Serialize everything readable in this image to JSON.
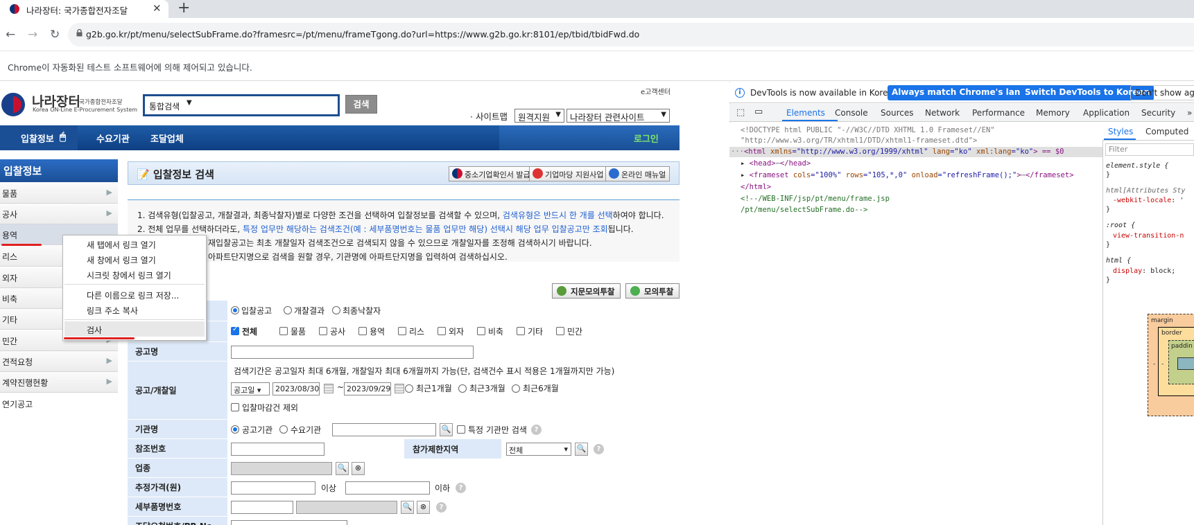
{
  "browser": {
    "tab_title": "나라장터: 국가종합전자조달",
    "tab_close": "✕",
    "new_tab": "+",
    "url": "g2b.go.kr/pt/menu/selectSubFrame.do?framesrc=/pt/menu/frameTgong.do?url=https://www.g2b.go.kr:8101/ep/tbid/tbidFwd.do",
    "automation_notice": "Chrome이 자동화된 테스트 소프트웨어에 의해 제어되고 있습니다."
  },
  "site": {
    "logo_name": "나라장터",
    "logo_sub": "국가종합전자조달",
    "logo_en": "Korea ON-Line E-Procurement System",
    "ecenter": "e고객센터",
    "search_select": "통합검색",
    "search_button": "검색",
    "sitemap": "· 사이트맵",
    "remote_support": "원격지원",
    "related_sites": "나라장터 관련사이트",
    "gnb": [
      "입찰정보",
      "수요기관",
      "조달업체"
    ],
    "login": "로그인"
  },
  "left_nav": {
    "title": "입찰정보",
    "items": [
      "물품",
      "공사",
      "용역",
      "리스",
      "외자",
      "비축",
      "기타",
      "민간",
      "견적요청",
      "계약진행현황",
      "연기공고"
    ]
  },
  "context_menu": {
    "items": [
      "새 탭에서 링크 열기",
      "새 창에서 링크 열기",
      "시크릿 창에서 링크 열기",
      "다른 이름으로 링크 저장...",
      "링크 주소 복사",
      "검사"
    ]
  },
  "page_header": {
    "title": "입찰정보 검색",
    "buttons": [
      "중소기업확인서 발급",
      "기업마당 지원사업",
      "온라인 매뉴얼"
    ]
  },
  "notes": {
    "n1_a": "1. 검색유형(입찰공고, 개찰결과, 최종낙찰자)별로 다양한 조건을 선택하여 입찰정보를 검색할 수 있으며,",
    "n1_b": "검색유형은 반드시 한 개를 선택",
    "n1_c": "하여야 합니다.",
    "n2_a": "2. 전체 업무를 선택하더라도,",
    "n2_b": "특정 업무만 해당하는 검색조건(예 : 세부품명번호는 물품 업무만 해당) 선택시 해당 업무 입찰공고만 조회",
    "n2_c": "됩니다.",
    "n3": "재입찰공고는 최초 개찰일자 검색조건으로 검색되지 않을 수 있으므로 개찰일자를 조정해 검색하시기 바랍니다.",
    "n4": "아파트단지명으로 검색을 원할 경우, 기관명에 아파트단지명을 입력하여 검색하십시오."
  },
  "action_buttons": {
    "fingerprint": "지문모의투찰",
    "mock": "모의투찰"
  },
  "form": {
    "search_types": [
      "입찰공고",
      "개찰결과",
      "최종낙찰자"
    ],
    "tasks": [
      "전체",
      "물품",
      "공사",
      "용역",
      "리스",
      "외자",
      "비축",
      "기타",
      "민간"
    ],
    "label_notice_name": "공고명",
    "label_date": "공고/개찰일",
    "date_note": "검색기간은 공고일자 최대 6개월, 개찰일자 최대 6개월까지 가능(단, 검색건수 표시 적용은 1개월까지만 가능)",
    "date_type": "공고일",
    "date_from": "2023/08/30",
    "tilde": "~",
    "date_to": "2023/09/29",
    "ranges": [
      "최근1개월",
      "최근3개월",
      "최근6개월"
    ],
    "exclude_deadline": "입찰마감건 제외",
    "label_org": "기관명",
    "org_types": [
      "공고기관",
      "수요기관"
    ],
    "org_specific": "특정 기관만 검색",
    "label_ref": "참조번호",
    "label_region": "참가제한지역",
    "region_value": "전체",
    "label_industry": "업종",
    "label_price": "추정가격(원)",
    "price_min": "이상",
    "price_max": "이하",
    "label_item_no": "세부품명번호",
    "label_pr_no": "조달요청번호/PR No."
  },
  "devtools": {
    "info": "DevTools is now available in Korean!",
    "btn_match": "Always match Chrome's language",
    "btn_switch": "Switch DevTools to Korean",
    "btn_dont": "Don't show again",
    "tabs": [
      "Elements",
      "Console",
      "Sources",
      "Network",
      "Performance",
      "Memory",
      "Application",
      "Security"
    ],
    "more": "»",
    "dom": {
      "l1": "<!DOCTYPE html PUBLIC \"-//W3C//DTD XHTML 1.0 Frameset//EN\"",
      "l2": "\"http://www.w3.org/TR/xhtml1/DTD/xhtml1-frameset.dtd\">",
      "l3_dots": "···",
      "l3_tag": "<html",
      "l3_a1": " xmlns",
      "l3_v1": "=\"http://www.w3.org/1999/xhtml\"",
      "l3_a2": " lang",
      "l3_v2": "=\"ko\"",
      "l3_a3": " xml:lang",
      "l3_v3": "=\"ko\"",
      "l3_end": "> == $0",
      "l4": "<head>",
      "l4_end": "</head>",
      "l5_tag": "<frameset",
      "l5_a1": " cols",
      "l5_v1": "=\"100%\"",
      "l5_a2": " rows",
      "l5_v2": "=\"105,*,0\"",
      "l5_a3": " onload",
      "l5_v3": "=\"refreshFrame();\"",
      "l5_end": "</frameset>",
      "l6": "</html>",
      "l7": "<!--/WEB-INF/jsp/pt/menu/frame.jsp",
      "l8": "/pt/menu/selectSubFrame.do-->",
      "ellipsis": "⋯"
    },
    "styles_tabs": [
      "Styles",
      "Computed"
    ],
    "filter": "Filter",
    "styles": {
      "s1": "element.style {",
      "s1_close": "}",
      "s2": "html[Attributes Sty",
      "s2_prop": "-webkit-locale",
      "s2_val": ": '",
      "s2_close": "}",
      "s3": ":root {",
      "s3_prop": "view-transition-n",
      "s3_close": "}",
      "s4": "html {",
      "s4_prop": "display",
      "s4_val": ": block;",
      "s4_close": "}"
    },
    "box": {
      "margin": "margin",
      "border": "border",
      "padding": "paddin",
      "dash": "-"
    }
  }
}
